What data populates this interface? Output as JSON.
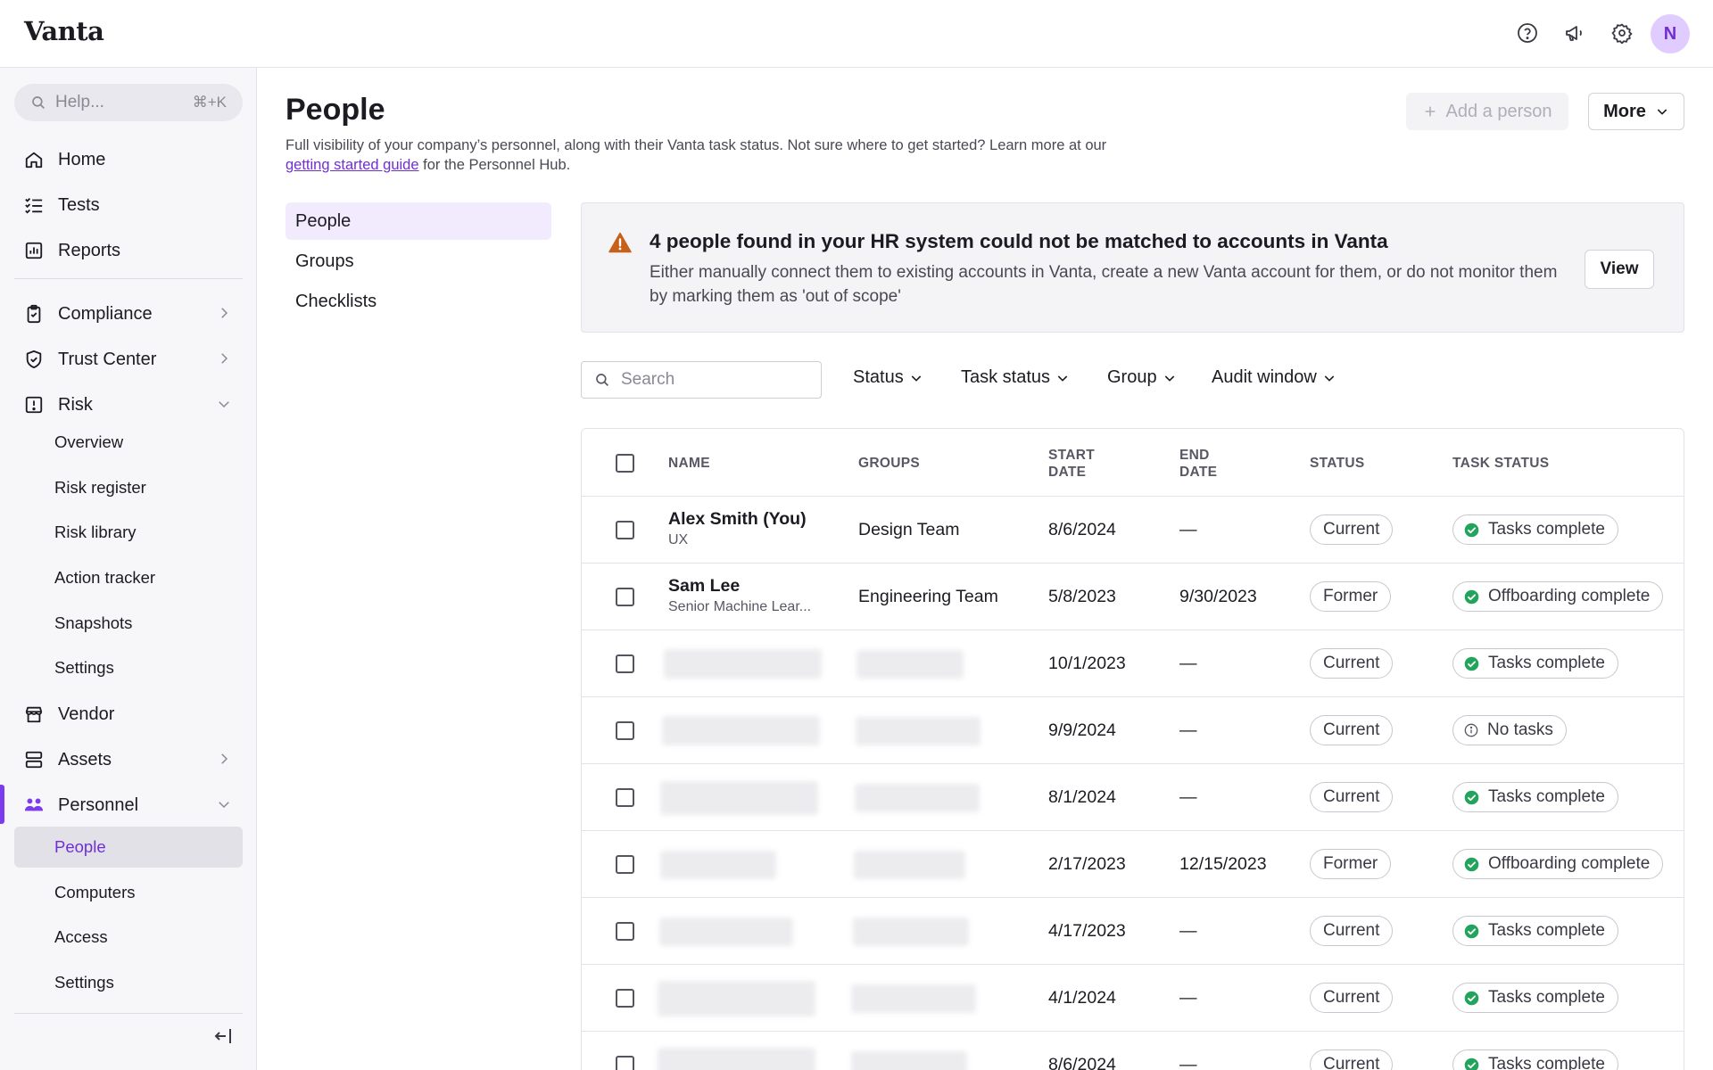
{
  "brand": {
    "name": "Vanta",
    "accent": "#7c3bed",
    "link_color": "#6f2fd3"
  },
  "header": {
    "icons": [
      "help-icon",
      "announcement-icon",
      "gear-icon"
    ],
    "avatar_initial": "N"
  },
  "sidebar": {
    "search_placeholder": "Help...",
    "search_shortcut": "⌘+K",
    "items": [
      {
        "label": "Home",
        "icon": "home-icon"
      },
      {
        "label": "Tests",
        "icon": "tests-icon"
      },
      {
        "label": "Reports",
        "icon": "reports-icon"
      },
      {
        "label": "Compliance",
        "icon": "clipboard-icon"
      },
      {
        "label": "Trust Center",
        "icon": "shield-icon"
      },
      {
        "label": "Risk",
        "icon": "risk-icon"
      },
      {
        "label": "Vendor",
        "icon": "vendor-icon"
      },
      {
        "label": "Assets",
        "icon": "assets-icon"
      },
      {
        "label": "Personnel",
        "icon": "personnel-icon"
      }
    ],
    "risk_sub": [
      "Overview",
      "Risk register",
      "Risk library",
      "Action tracker",
      "Snapshots",
      "Settings"
    ],
    "personnel_sub": [
      "People",
      "Computers",
      "Access",
      "Settings"
    ]
  },
  "main": {
    "title": "People",
    "desc_before": "Full visibility of your company’s personnel, along with their Vanta task status. Not sure where to get started? Learn more at our ",
    "desc_link": "getting started guide",
    "desc_after": " for the Personnel Hub.",
    "add_button": "Add a person",
    "more_button": "More",
    "subnav": [
      "People",
      "Groups",
      "Checklists"
    ]
  },
  "banner": {
    "title": "4 people found in your HR system could not be matched to accounts in Vanta",
    "body": "Either manually connect them to existing accounts in Vanta, create a new Vanta account for them, or do not monitor them by marking them as 'out of scope'",
    "button": "View",
    "warning_color": "#c6601a"
  },
  "filters": {
    "search_placeholder": "Search",
    "items": [
      "Status",
      "Task status",
      "Group",
      "Audit window"
    ]
  },
  "table": {
    "headers": {
      "name": "NAME",
      "groups": "GROUPS",
      "start_1": "START",
      "start_2": "DATE",
      "end_1": "END",
      "end_2": "DATE",
      "status": "STATUS",
      "task_status": "TASK STATUS"
    },
    "rows": [
      {
        "name": "Alex Smith (You)",
        "role": "UX",
        "group": "Design Team",
        "start": "8/6/2024",
        "end": "—",
        "status": "Current",
        "task": "Tasks complete",
        "task_icon": "check-circle-icon"
      },
      {
        "name": "Sam Lee",
        "role": "Senior Machine Lear...",
        "group": "Engineering Team",
        "start": "5/8/2023",
        "end": "9/30/2023",
        "status": "Former",
        "task": "Offboarding complete",
        "task_icon": "check-circle-icon"
      },
      {
        "name": "",
        "role": "",
        "group": "",
        "start": "10/1/2023",
        "end": "—",
        "status": "Current",
        "task": "Tasks complete",
        "task_icon": "check-circle-icon"
      },
      {
        "name": "",
        "role": "",
        "group": "",
        "start": "9/9/2024",
        "end": "—",
        "status": "Current",
        "task": "No tasks",
        "task_icon": "info-icon"
      },
      {
        "name": "",
        "role": "",
        "group": "",
        "start": "8/1/2024",
        "end": "—",
        "status": "Current",
        "task": "Tasks complete",
        "task_icon": "check-circle-icon"
      },
      {
        "name": "",
        "role": "",
        "group": "",
        "start": "2/17/2023",
        "end": "12/15/2023",
        "status": "Former",
        "task": "Offboarding complete",
        "task_icon": "check-circle-icon"
      },
      {
        "name": "",
        "role": "",
        "group": "",
        "start": "4/17/2023",
        "end": "—",
        "status": "Current",
        "task": "Tasks complete",
        "task_icon": "check-circle-icon"
      },
      {
        "name": "",
        "role": "",
        "group": "",
        "start": "4/1/2024",
        "end": "—",
        "status": "Current",
        "task": "Tasks complete",
        "task_icon": "check-circle-icon"
      },
      {
        "name": "",
        "role": "",
        "group": "",
        "start": "8/6/2024",
        "end": "—",
        "status": "Current",
        "task": "Tasks complete",
        "task_icon": "check-circle-icon"
      }
    ]
  }
}
